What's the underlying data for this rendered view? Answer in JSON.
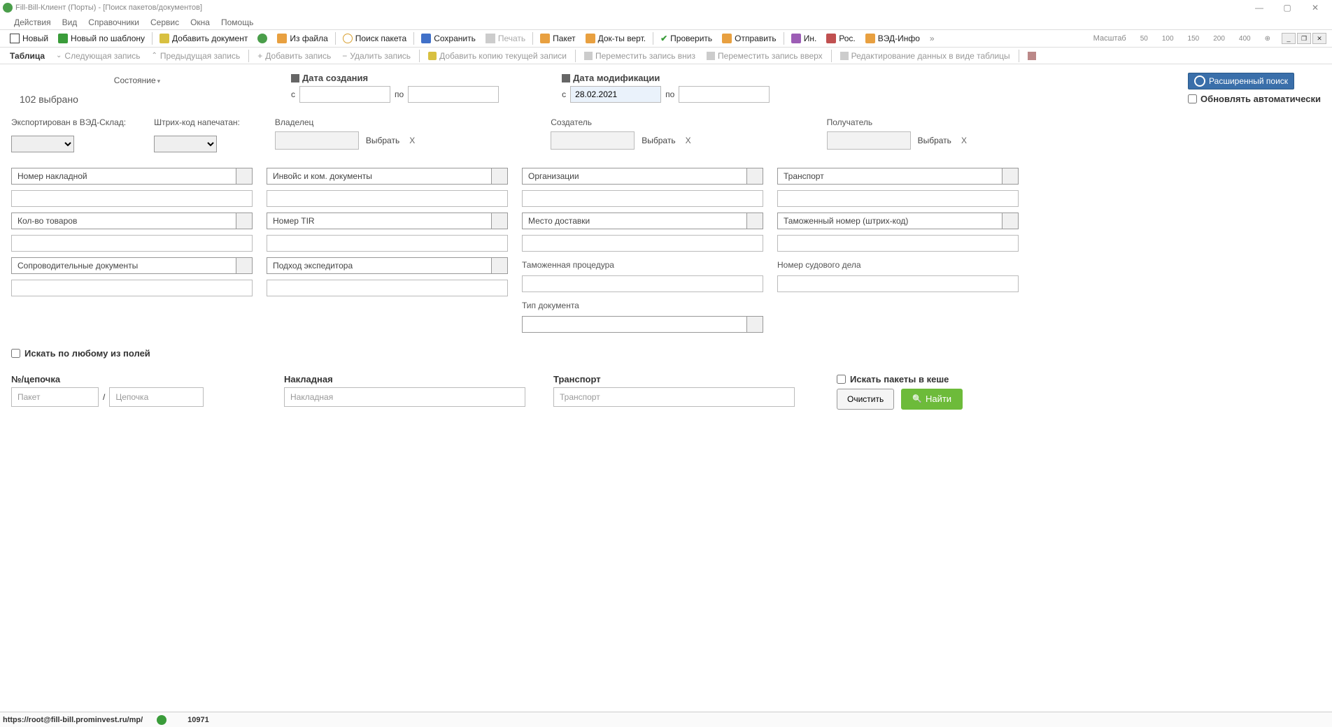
{
  "title": "Fill-Bill-Клиент (Порты) - [Поиск пакетов/документов]",
  "menu": [
    "Действия",
    "Вид",
    "Справочники",
    "Сервис",
    "Окна",
    "Помощь"
  ],
  "toolbar": {
    "new": "Новый",
    "new_tpl": "Новый по шаблону",
    "add_doc": "Добавить документ",
    "from_file": "Из файла",
    "search_pkg": "Поиск пакета",
    "save": "Сохранить",
    "print": "Печать",
    "packet": "Пакет",
    "docs_vert": "Док-ты верт.",
    "check": "Проверить",
    "send": "Отправить",
    "in": "Ин.",
    "ros": "Рос.",
    "ved_info": "ВЭД-Инфо",
    "zoom_label": "Масштаб",
    "zoom_values": [
      "50",
      "100",
      "150",
      "200",
      "400"
    ]
  },
  "toolbar2": {
    "table": "Таблица",
    "next": "Следующая запись",
    "prev": "Предыдущая запись",
    "add": "Добавить запись",
    "del": "Удалить запись",
    "copy": "Добавить копию текущей записи",
    "move_down": "Переместить запись вниз",
    "move_up": "Переместить запись вверх",
    "edit_table": "Редактирование данных в виде таблицы"
  },
  "search": {
    "state_label": "Состояние",
    "selected": "102 выбрано",
    "date_created": "Дата создания",
    "date_modified": "Дата модификации",
    "from": "с",
    "to": "по",
    "mod_from_value": "28.02.2021",
    "adv_search": "Расширенный поиск",
    "auto_refresh": "Обновлять автоматически",
    "exported_label": "Экспортирован в ВЭД-Склад:",
    "barcode_printed": "Штрих-код напечатан:",
    "owner": "Владелец",
    "creator": "Создатель",
    "recipient": "Получатель",
    "select_btn": "Выбрать",
    "filters": {
      "c1": [
        "Номер накладной",
        "Кол-во товаров",
        "Сопроводительные документы"
      ],
      "c2": [
        "Инвойс и ком. документы",
        "Номер TIR",
        "Подход экспедитора"
      ],
      "c3": [
        "Организации",
        "Место доставки"
      ],
      "c4": [
        "Транспорт",
        "Таможенный номер (штрих-код)"
      ],
      "customs_proc": "Таможенная процедура",
      "doc_type": "Тип документа",
      "vessel_case": "Номер судового дела"
    },
    "any_field": "Искать по любому из полей",
    "no_chain": "№/цепочка",
    "packet_ph": "Пакет",
    "chain_ph": "Цепочка",
    "waybill": "Накладная",
    "waybill_ph": "Накладная",
    "transport": "Транспорт",
    "transport_ph": "Транспорт",
    "cache_search": "Искать пакеты в кеше",
    "clear": "Очистить",
    "find": "Найти"
  },
  "status": {
    "url": "https://root@fill-bill.prominvest.ru/mp/",
    "num": "10971"
  }
}
